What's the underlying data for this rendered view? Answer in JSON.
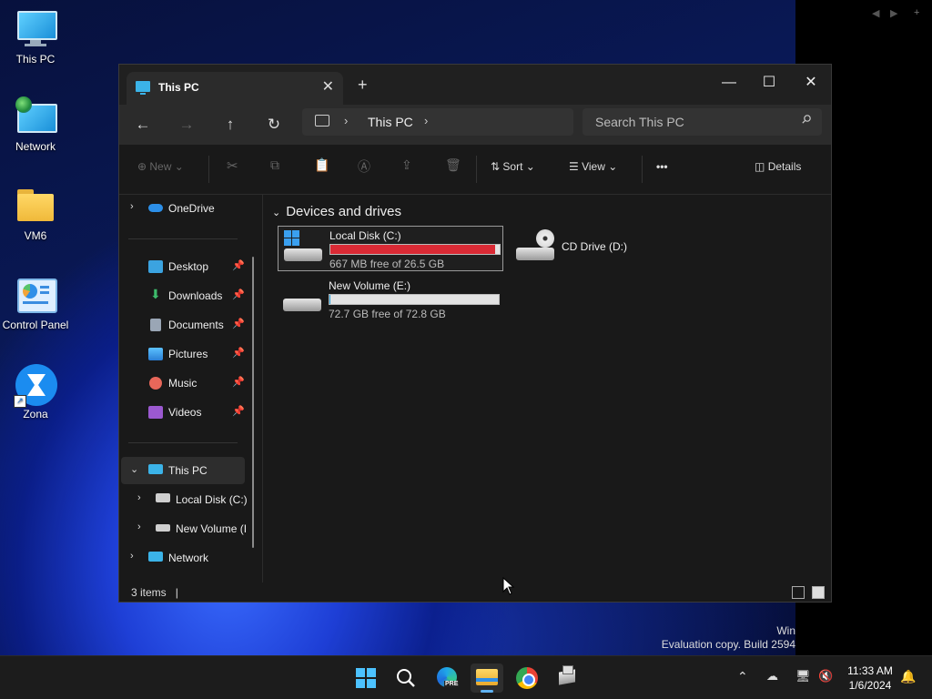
{
  "desktop": {
    "icons": [
      {
        "label": "This PC",
        "icon": "computer-icon"
      },
      {
        "label": "Network",
        "icon": "network-icon"
      },
      {
        "label": "VM6",
        "icon": "folder-icon"
      },
      {
        "label": "Control Panel",
        "icon": "control-panel-icon"
      },
      {
        "label": "Zona",
        "icon": "zona-icon"
      }
    ]
  },
  "window": {
    "tab_title": "This PC",
    "new_tab": "+",
    "controls": {
      "minimize": "—",
      "maximize": "☐",
      "close": "✕"
    },
    "address": {
      "segment": "This PC"
    },
    "search": {
      "placeholder": "Search This PC"
    },
    "toolbar": {
      "new_label": "New",
      "sort_label": "Sort",
      "view_label": "View",
      "more_label": "•••",
      "details_label": "Details"
    },
    "sidebar": {
      "onedrive": "OneDrive",
      "pinned": [
        {
          "label": "Desktop",
          "color": "#3ba3e0"
        },
        {
          "label": "Downloads",
          "color": "#3dbb6b"
        },
        {
          "label": "Documents",
          "color": "#9aa6b5"
        },
        {
          "label": "Pictures",
          "color": "#3b8de0"
        },
        {
          "label": "Music",
          "color": "#e8675a"
        },
        {
          "label": "Videos",
          "color": "#9b59d0"
        }
      ],
      "this_pc": "This PC",
      "local_disk": "Local Disk (C:)",
      "new_volume": "New Volume (I",
      "network": "Network"
    },
    "content": {
      "group_title": "Devices and drives",
      "drives": [
        {
          "name": "Local Disk (C:)",
          "free_text": "667 MB free of 26.5 GB",
          "used_fraction": 0.975,
          "bar_color": "#da2a35"
        },
        {
          "name": "CD Drive (D:)"
        },
        {
          "name": "New Volume (E:)",
          "free_text": "72.7 GB free of 72.8 GB",
          "used_fraction": 0.002,
          "bar_color": "#26a0da"
        }
      ]
    },
    "status": {
      "items": "3 items",
      "cursor": "|"
    }
  },
  "watermark": {
    "line1": "Win",
    "line2": "Evaluation copy. Build 2594"
  },
  "taskbar": {
    "apps": [
      "start-icon",
      "search-icon",
      "edge-pre-icon",
      "file-explorer-icon",
      "chrome-icon",
      "app-icon"
    ],
    "edge_badge": "PRE",
    "time": "11:33 AM",
    "date": "1/6/2024"
  },
  "right_panel": {
    "controls": [
      "◀",
      "▶",
      "+"
    ]
  }
}
